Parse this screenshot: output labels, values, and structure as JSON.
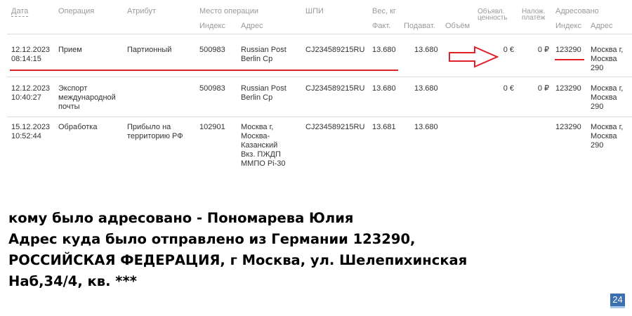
{
  "headers": {
    "date": "Дата",
    "operation": "Операция",
    "attribute": "Атрибут",
    "place": "Место операции",
    "place_index": "Индекс",
    "place_address": "Адрес",
    "shpi": "ШПИ",
    "weight": "Вес, кг",
    "weight_actual": "Факт.",
    "weight_declared": "Подават.",
    "volume": "Объём",
    "declared_value_1": "Объявл.",
    "declared_value_2": "ценность",
    "cod_1": "Налож.",
    "cod_2": "платёж",
    "addressed": "Адресовано",
    "addressed_index": "Индекс",
    "addressed_address": "Адрес"
  },
  "rows": [
    {
      "date": "12.12.2023",
      "time": "08:14:15",
      "operation": [
        "Прием"
      ],
      "attribute": [
        "Партионный"
      ],
      "place_index": "500983",
      "place_address": [
        "Russian Post",
        "Berlin Cp"
      ],
      "shpi": "CJ234589215RU",
      "weight_actual": "13.680",
      "weight_declared": "13.680",
      "declared_value": "0 €",
      "cod": "0 ₽",
      "addr_index": "123290",
      "addr_address": [
        "Москва г,",
        "Москва",
        "290"
      ]
    },
    {
      "date": "12.12.2023",
      "time": "10:40:27",
      "operation": [
        "Экспорт",
        "международной",
        "почты"
      ],
      "attribute": [],
      "place_index": "500983",
      "place_address": [
        "Russian Post",
        "Berlin Cp"
      ],
      "shpi": "CJ234589215RU",
      "weight_actual": "13.680",
      "weight_declared": "13.680",
      "declared_value": "0 €",
      "cod": "0 ₽",
      "addr_index": "123290",
      "addr_address": [
        "Москва г,",
        "Москва",
        "290"
      ]
    },
    {
      "date": "15.12.2023",
      "time": "10:52:44",
      "operation": [
        "Обработка"
      ],
      "attribute": [
        "Прибыло на",
        "территорию РФ"
      ],
      "place_index": "102901",
      "place_address": [
        "Москва г,",
        "Москва-",
        "Казанский",
        "Вкз. ПЖДП",
        "ММПО Pi-30"
      ],
      "shpi": "CJ234589215RU",
      "weight_actual": "13.681",
      "weight_declared": "13.680",
      "declared_value": "",
      "cod": "",
      "addr_index": "123290",
      "addr_address": [
        "Москва г,",
        "Москва",
        "290"
      ]
    }
  ],
  "message": {
    "line1": "кому было адресовано - Пономарева Юлия",
    "line2": "Адрес куда было отправлено из Германии 123290,",
    "line3": "РОССИЙСКАЯ ФЕДЕРАЦИЯ,  г Москва, ул. Шелепихинская",
    "line4": "Наб,34/4, кв. ***"
  },
  "badge": "24",
  "colors": {
    "annotation_red": "#e0202a",
    "badge_blue": "#3b6fb0",
    "header_gray": "#9a9a9a"
  }
}
